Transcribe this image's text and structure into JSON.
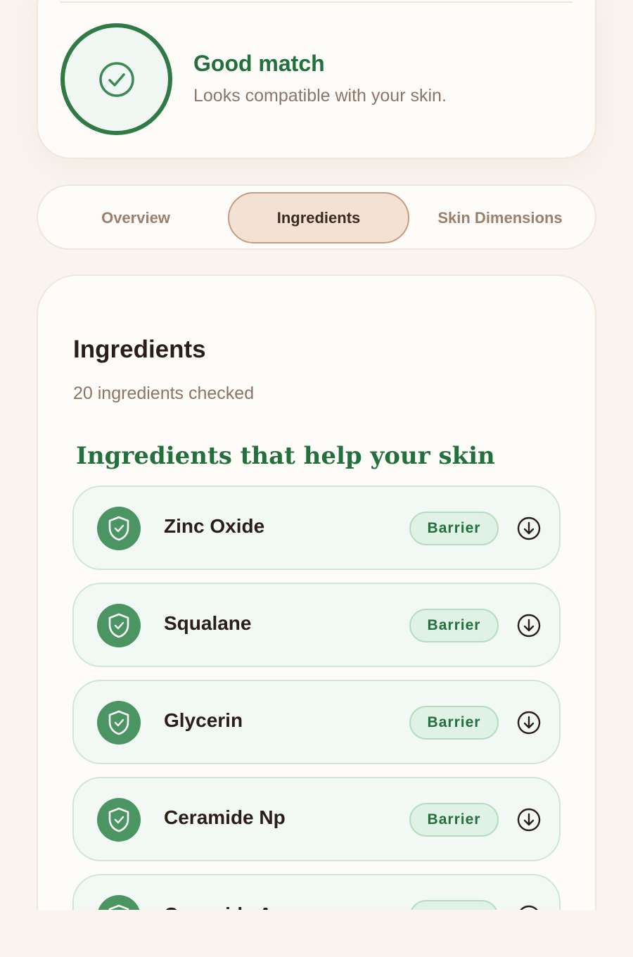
{
  "match": {
    "title": "Good match",
    "subtitle": "Looks compatible with your skin.",
    "icon": "check-circle-icon",
    "accent": "#2f7a45"
  },
  "tabs": [
    {
      "label": "Overview",
      "active": false
    },
    {
      "label": "Ingredients",
      "active": true
    },
    {
      "label": "Skin Dimensions",
      "active": false
    }
  ],
  "ingredients": {
    "title": "Ingredients",
    "count_text": "20 ingredients checked",
    "section_heading": "Ingredients that help your skin",
    "items": [
      {
        "name": "Zinc Oxide",
        "tag": "Barrier",
        "icon": "shield-check-icon"
      },
      {
        "name": "Squalane",
        "tag": "Barrier",
        "icon": "shield-check-icon"
      },
      {
        "name": "Glycerin",
        "tag": "Barrier",
        "icon": "shield-check-icon"
      },
      {
        "name": "Ceramide Np",
        "tag": "Barrier",
        "icon": "shield-check-icon"
      },
      {
        "name": "Ceramide Ap",
        "tag": "Barrier",
        "icon": "shield-check-icon"
      }
    ]
  },
  "colors": {
    "background": "#f9f4ef",
    "card": "#fefcf8",
    "green": "#22703c",
    "tab_active": "#f3e1d4"
  }
}
